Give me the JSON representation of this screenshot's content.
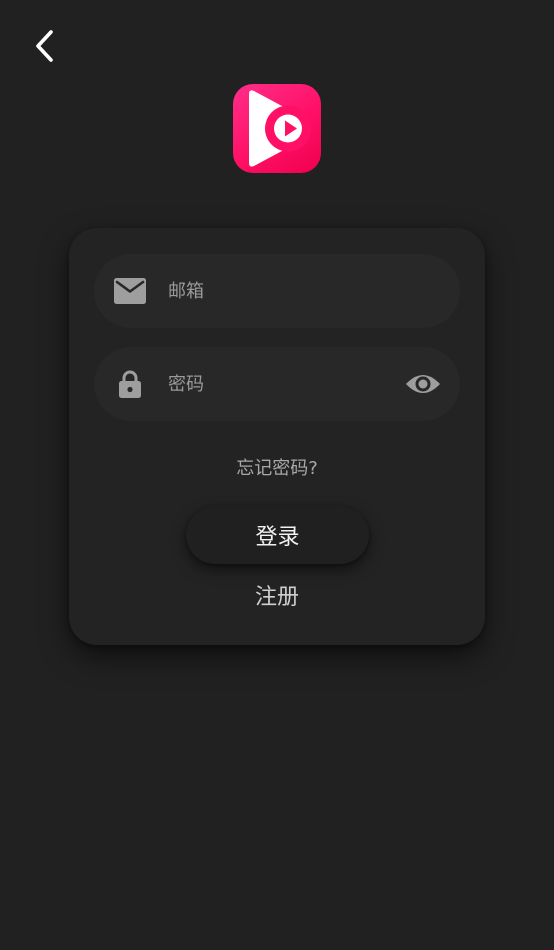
{
  "nav": {
    "back_icon": "chevron-left-icon"
  },
  "logo": {
    "icon": "video-play-logo",
    "gradient_start": "#ff2f8a",
    "gradient_end": "#f0004e"
  },
  "login_form": {
    "email": {
      "icon": "mail-icon",
      "placeholder": "邮箱",
      "value": ""
    },
    "password": {
      "icon": "lock-icon",
      "placeholder": "密码",
      "value": "",
      "toggle_icon": "eye-icon"
    },
    "forgot_label": "忘记密码?",
    "login_label": "登录",
    "register_label": "注册"
  },
  "theme": {
    "background": "#212121",
    "card": "#232323",
    "field": "#282828",
    "icon_color": "#9e9e9e",
    "accent": "#ff1066"
  }
}
